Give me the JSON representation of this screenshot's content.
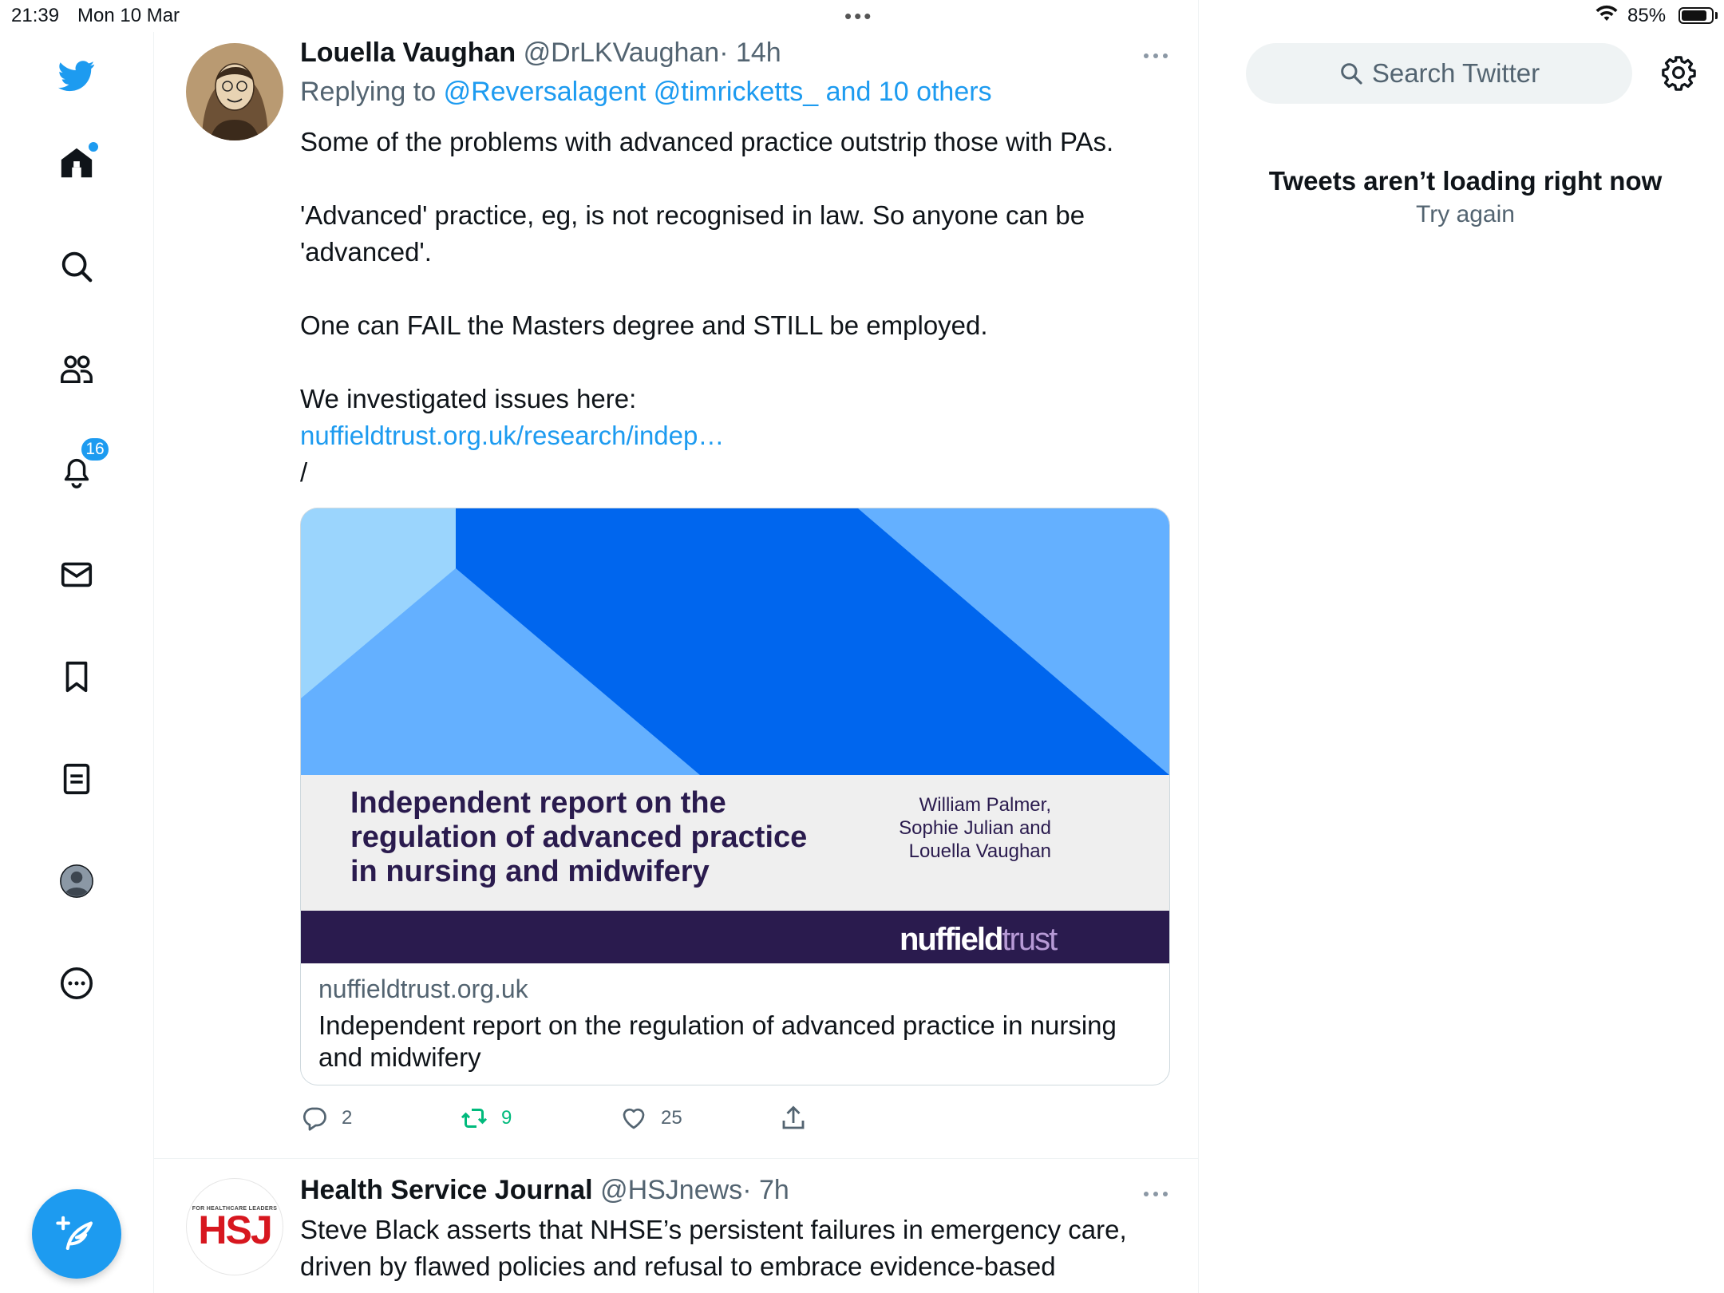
{
  "status_bar": {
    "time": "21:39",
    "date": "Mon 10 Mar",
    "battery": "85%",
    "battery_level": 0.85
  },
  "nav": {
    "notifications_count": "16",
    "items": [
      "twitter-logo",
      "home",
      "explore",
      "communities",
      "notifications",
      "messages",
      "bookmarks",
      "lists",
      "profile",
      "more"
    ]
  },
  "tweets": [
    {
      "author": "Louella Vaughan",
      "handle": "@DrLKVaughan",
      "time": "· 14h",
      "replying_prefix": "Replying to",
      "replying_to": "@Reversalagent @timricketts_ and 10 others",
      "body": {
        "line1": "Some of the problems with advanced practice outstrip those with PAs.",
        "line2": "'Advanced' practice, eg, is not recognised in law. So anyone can be 'advanced'.",
        "line3": "One can FAIL the Masters degree and STILL be employed.",
        "line4": "We investigated issues here:",
        "link": "nuffieldtrust.org.uk/research/indep…",
        "line5": "/"
      },
      "card": {
        "image_title": "Independent report on the regulation of advanced practice in nursing and midwifery",
        "image_authors_1": "William Palmer,",
        "image_authors_2": "Sophie Julian and",
        "image_authors_3": "Louella Vaughan",
        "brand_part1": "nuffield",
        "brand_part2": "trust",
        "domain": "nuffieldtrust.org.uk",
        "title": "Independent report on the regulation of advanced practice in nursing and midwifery"
      },
      "actions": {
        "replies": "2",
        "retweets": "9",
        "likes": "25"
      }
    },
    {
      "author": "Health Service Journal",
      "handle": "@HSJnews",
      "time": "· 7h",
      "avatar_small": "FOR HEALTHCARE LEADERS",
      "avatar_big": "HSJ",
      "body_line1": "Steve Black asserts that NHSE’s persistent failures in emergency care,",
      "body_line2": "driven by flawed policies and refusal to embrace evidence-based"
    }
  ],
  "sidebar": {
    "search_placeholder": "Search Twitter",
    "error_title": "Tweets aren’t loading right now",
    "error_retry": "Try again"
  },
  "colors": {
    "accent": "#1d9bf0",
    "retweet": "#00ba7c",
    "muted": "#536471",
    "nuffield_purple": "#2a1b4e"
  }
}
